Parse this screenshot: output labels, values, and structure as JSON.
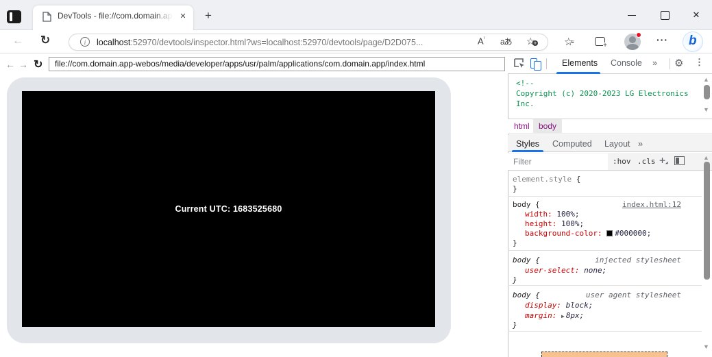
{
  "window": {
    "tab": {
      "title": "DevTools - file://com.domain.app",
      "close_glyph": "✕"
    },
    "new_tab_glyph": "+",
    "controls": {
      "close_glyph": "✕"
    }
  },
  "toolbar": {
    "back_glyph": "←",
    "refresh_glyph": "↻",
    "info_glyph": "i",
    "url": {
      "host": "localhost",
      "rest": ":52970/devtools/inspector.html?ws=localhost:52970/devtools/page/D2D075..."
    },
    "read_aloud_glyph": "A",
    "translate_glyph": "aあ",
    "favorite_add_glyph": "☆",
    "favorites_hub_glyph": "☆",
    "more_glyph": "···",
    "bing_glyph": "b"
  },
  "page_nav": {
    "back_glyph": "←",
    "forward_glyph": "→",
    "refresh_glyph": "↻",
    "url": "file://com.domain.app-webos/media/developer/apps/usr/palm/applications/com.domain.app/index.html"
  },
  "device": {
    "screen_text": "Current UTC: 1683525680"
  },
  "devtools": {
    "panel_tabs": {
      "elements": "Elements",
      "console": "Console",
      "more": "»",
      "gear": "⚙",
      "kebab": "⋮"
    },
    "dom_tree": {
      "line1": "<!--",
      "line2": "Copyright (c) 2020-2023 LG Electronics",
      "line3": "Inc."
    },
    "breadcrumb": {
      "html": "html",
      "body": "body"
    },
    "sidebar_tabs": {
      "styles": "Styles",
      "computed": "Computed",
      "layout": "Layout",
      "more": "»"
    },
    "filter": {
      "placeholder": "Filter",
      "hov": ":hov",
      "cls": ".cls",
      "add": "+"
    },
    "rules": {
      "element_style": {
        "selector": "element.style",
        "open": " {",
        "close": "}"
      },
      "body_main": {
        "selector": "body",
        "open": " {",
        "close": "}",
        "source": "index.html:12",
        "prop1": {
          "name": "width:",
          "value": "100%;"
        },
        "prop2": {
          "name": "height:",
          "value": "100%;"
        },
        "prop3": {
          "name": "background-color:",
          "value": "#000000;"
        }
      },
      "body_injected": {
        "selector": "body",
        "open": " {",
        "close": "}",
        "origin": "injected stylesheet",
        "prop1": {
          "name": "user-select:",
          "value": "none;"
        }
      },
      "body_ua": {
        "selector": "body",
        "open": " {",
        "close": "}",
        "origin": "user agent stylesheet",
        "prop1": {
          "name": "display:",
          "value": "block;"
        },
        "prop2": {
          "name": "margin:",
          "value": "8px;",
          "expand_glyph": "▶"
        }
      }
    },
    "scroll": {
      "up_glyph": "▲",
      "down_glyph": "▼"
    }
  }
}
